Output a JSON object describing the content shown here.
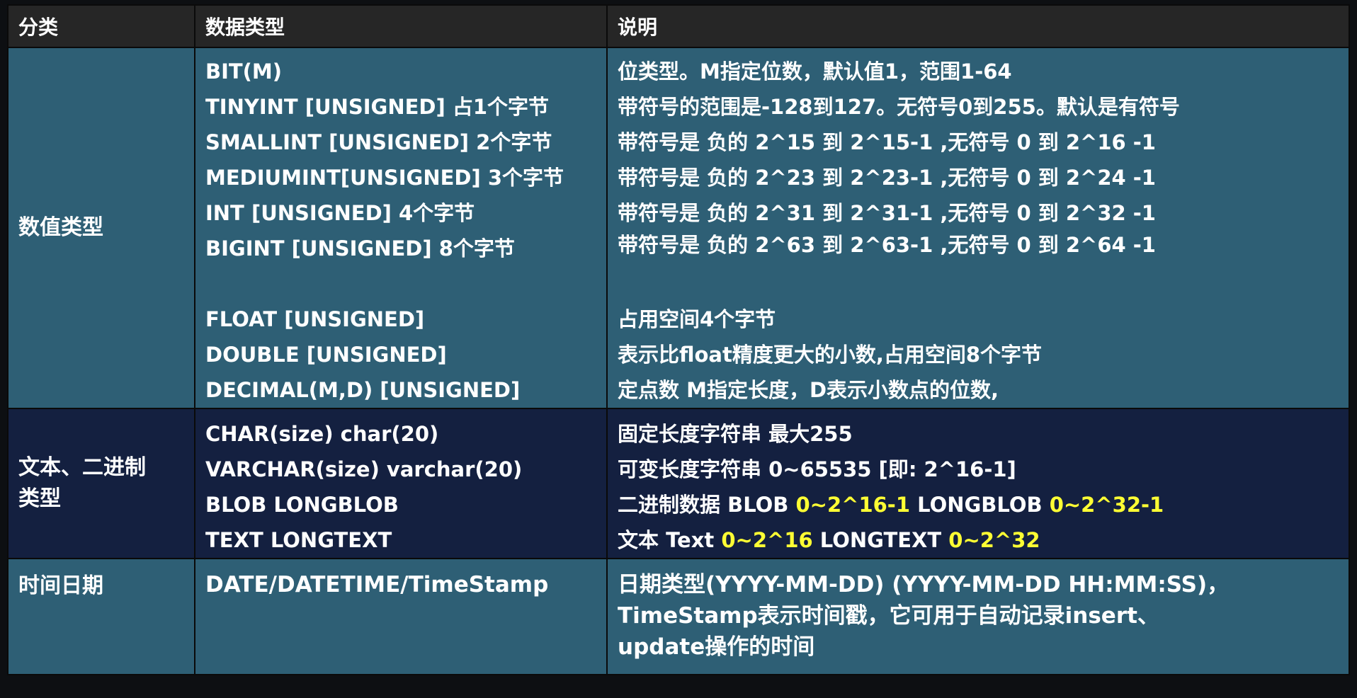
{
  "header": {
    "col_category": "分类",
    "col_type": "数据类型",
    "col_desc": "说明"
  },
  "numeric": {
    "category": "数值类型",
    "types": [
      "BIT(M)",
      "TINYINT [UNSIGNED]   占1个字节",
      "SMALLINT [UNSIGNED]  2个字节",
      "MEDIUMINT[UNSIGNED] 3个字节",
      "INT [UNSIGNED]  4个字节",
      "BIGINT [UNSIGNED] 8个字节",
      "",
      "FLOAT [UNSIGNED]",
      "DOUBLE [UNSIGNED]",
      "DECIMAL(M,D) [UNSIGNED]"
    ],
    "descs": [
      "位类型。M指定位数，默认值1，范围1-64",
      "带符号的范围是-128到127。无符号0到255。默认是有符号",
      "带符号是  负的 2^15 到 2^15-1 ,无符号 0 到 2^16 -1",
      "带符号是  负的 2^23 到 2^23-1 ,无符号 0 到 2^24 -1",
      "带符号是  负的 2^31 到 2^31-1 ,无符号 0 到 2^32 -1",
      "带符号是  负的 2^63 到 2^63-1 ,无符号 0 到 2^64 -1",
      "",
      "占用空间4个字节",
      "表示比float精度更大的小数,占用空间8个字节",
      "定点数 M指定长度，D表示小数点的位数,"
    ]
  },
  "text": {
    "category_line1": "文本、二进制",
    "category_line2": "类型",
    "types": [
      "CHAR(size) char(20)",
      "VARCHAR(size)  varchar(20)",
      "BLOB   LONGBLOB",
      "TEXT   LONGTEXT"
    ],
    "desc0": "固定长度字符串 最大255",
    "desc1": "可变长度字符串 0~65535 [即: 2^16-1]",
    "desc2_a": "二进制数据 BLOB ",
    "desc2_b": "0~2^16-1",
    "desc2_c": " LONGBLOB ",
    "desc2_d": "0~2^32-1",
    "desc3_a": "文本 Text ",
    "desc3_b": "0~2^16",
    "desc3_c": " LONGTEXT ",
    "desc3_d": "0~2^32",
    "highlight_color": "#ffff33"
  },
  "datetime": {
    "category": "时间日期",
    "type": "DATE/DATETIME/TimeStamp",
    "desc_lines": [
      "日期类型(YYYY-MM-DD)  (YYYY-MM-DD HH:MM:SS)，",
      "TimeStamp表示时间戳，它可用于自动记录insert、",
      "update操作的时间"
    ]
  },
  "colors": {
    "header_bg": "#262626",
    "teal_row_bg": "#2e5f75",
    "navy_row_bg": "#142040"
  }
}
